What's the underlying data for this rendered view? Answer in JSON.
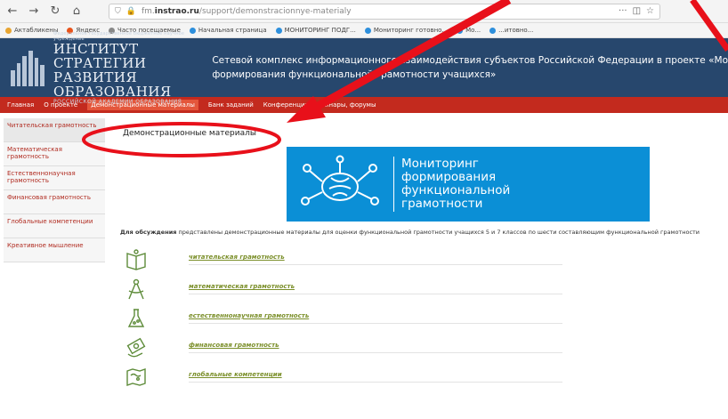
{
  "browser": {
    "url_prefix": "fm.",
    "url_domain": "instrao.ru",
    "url_path": "/support/demonstracionnye-materialy",
    "menu_dots": "···"
  },
  "bookmarks": [
    "Актабликены",
    "Яндекс",
    "Часто посещаемые",
    "Начальная страница",
    "МОНИТОРИНГ ПОДГ...",
    "Мониторинг готовно...",
    "Мо...",
    "...итовно..."
  ],
  "header": {
    "org_small": "Федеральное государственное бюджетное научное учреждение",
    "org_line1": "ИНСТИТУТ СТРАТЕГИИ",
    "org_line2": "РАЗВИТИЯ ОБРАЗОВАНИЯ",
    "org_tiny": "РОССИЙСКОЙ АКАДЕМИИ ОБРАЗОВАНИЯ",
    "title_line1": "Сетевой комплекс информационного взаимодействия субъектов Российской Федерации в проекте «Мо",
    "title_line2": "формирования функциональной грамотности учащихся»"
  },
  "nav": {
    "home": "Главная",
    "about": "О проекте",
    "demo": "Демонстрационные материалы",
    "tasks": "Банк заданий",
    "conf": "Конференции, семинары, форумы"
  },
  "sidebar": [
    "Читательская грамотность",
    "Математическая грамотность",
    "Естественнонаучная грамотность",
    "Финансовая грамотность",
    "Глобальные компетенции",
    "Креативное мышление"
  ],
  "main": {
    "page_title": "Демонстрационные материалы",
    "banner_line1": "Мониторинг",
    "banner_line2": "формирования",
    "banner_line3": "функциональной",
    "banner_line4": "грамотности",
    "intro_bold": "Для обсуждения",
    "intro_text": " представлены демонстрационные материалы для оценки функциональной грамотности учащихся 5 и 7 классов по шести составляющим функциональной грамотности",
    "materials": [
      {
        "label": "читательская грамотность",
        "icon": "book-icon"
      },
      {
        "label": "математическая грамотность",
        "icon": "compass-icon"
      },
      {
        "label": "естественнонаучная грамотность",
        "icon": "flask-icon"
      },
      {
        "label": "финансовая грамотность",
        "icon": "money-icon"
      },
      {
        "label": "глобальные компетенции",
        "icon": "globe-map-icon"
      }
    ]
  },
  "colors": {
    "header_bg": "#27476d",
    "nav_bg": "#c32a1e",
    "sidebar_text": "#b02a1f",
    "banner_bg": "#0b8fd6",
    "link": "#7b8f2a",
    "annotation": "#e8101a"
  }
}
